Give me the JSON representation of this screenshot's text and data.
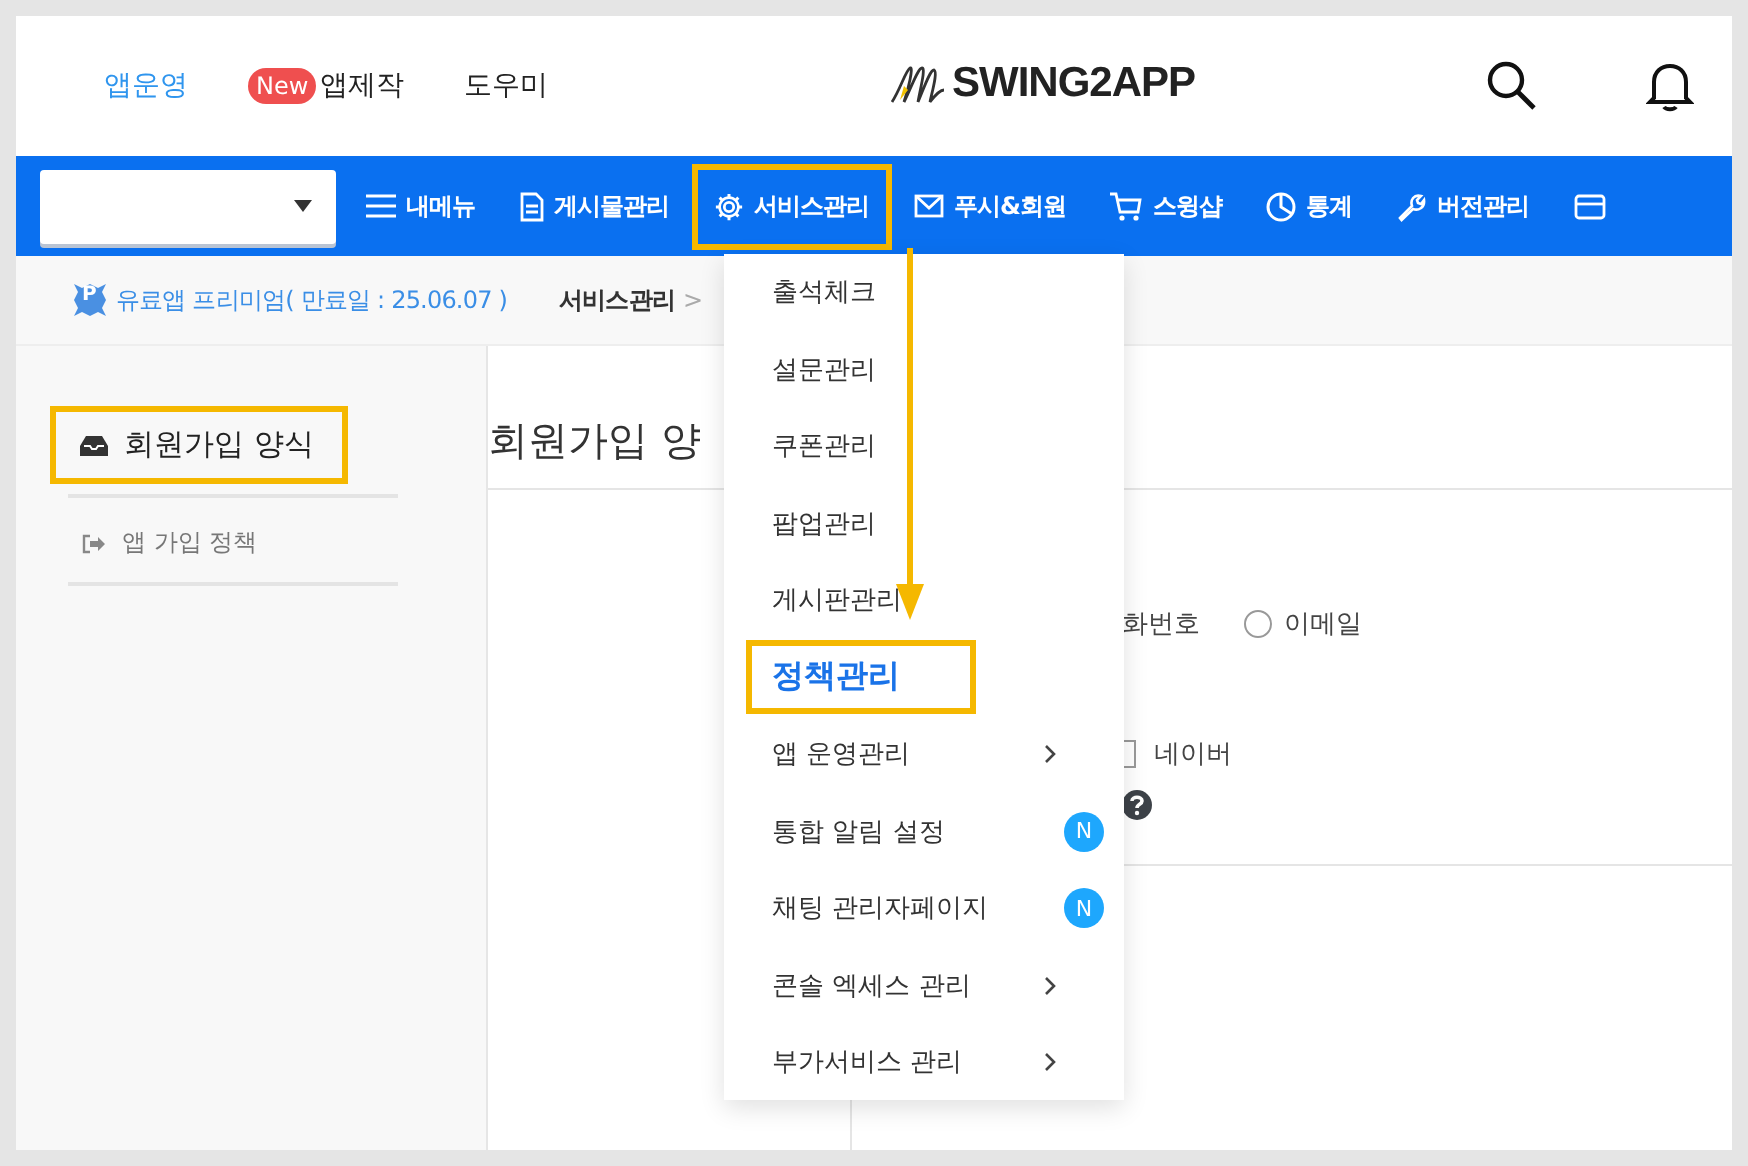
{
  "header": {
    "links": [
      {
        "label": "앱운영",
        "selected": true
      },
      {
        "label": "앱제작",
        "badge": "New",
        "selected": false
      },
      {
        "label": "도우미",
        "selected": false
      }
    ],
    "logo": "SWING2APP"
  },
  "nav": {
    "items": [
      {
        "label": "내메뉴",
        "highlighted": false
      },
      {
        "label": "게시물관리",
        "highlighted": false
      },
      {
        "label": "서비스관리",
        "highlighted": true
      },
      {
        "label": "푸시&회원",
        "highlighted": false
      },
      {
        "label": "스윙샵",
        "highlighted": false
      },
      {
        "label": "통계",
        "highlighted": false
      },
      {
        "label": "버전관리",
        "highlighted": false
      },
      {
        "highlighted": false
      }
    ]
  },
  "breadcrumb": {
    "badge": "P",
    "plan": "유료앱 프리미엄( 만료일 : 25.06.07 )",
    "current": "서비스관리",
    "separator": ">"
  },
  "sidebar": {
    "items": [
      {
        "label": "회원가입 양식",
        "selected": true,
        "highlighted": true
      },
      {
        "label": "앱 가입 정책",
        "selected": false,
        "highlighted": false
      }
    ]
  },
  "main": {
    "title": "회원가입 양",
    "phone_label": "화번호",
    "radio": {
      "label": "이메일",
      "checked": false
    },
    "checkbox": {
      "label": "네이버",
      "checked": false
    }
  },
  "menu": {
    "items": [
      {
        "label": "출석체크",
        "kind": "plain",
        "selected": false,
        "highlighted": false
      },
      {
        "label": "설문관리",
        "kind": "plain",
        "selected": false,
        "highlighted": false
      },
      {
        "label": "쿠폰관리",
        "kind": "plain",
        "selected": false,
        "highlighted": false
      },
      {
        "label": "팝업관리",
        "kind": "plain",
        "selected": false,
        "highlighted": false
      },
      {
        "label": "게시판관리",
        "kind": "plain",
        "selected": false,
        "highlighted": false
      },
      {
        "label": "정책관리",
        "kind": "plain",
        "selected": true,
        "highlighted": true
      },
      {
        "label": "앱 운영관리",
        "kind": "submenu",
        "selected": false,
        "highlighted": false
      },
      {
        "label": "통합 알림 설정",
        "kind": "new",
        "badge": "N",
        "selected": false,
        "highlighted": false
      },
      {
        "label": "채팅 관리자페이지",
        "kind": "new",
        "badge": "N",
        "selected": false,
        "highlighted": false
      },
      {
        "label": "콘솔 엑세스 관리",
        "kind": "submenu",
        "selected": false,
        "highlighted": false
      },
      {
        "label": "부가서비스 관리",
        "kind": "submenu",
        "selected": false,
        "highlighted": false
      }
    ]
  }
}
